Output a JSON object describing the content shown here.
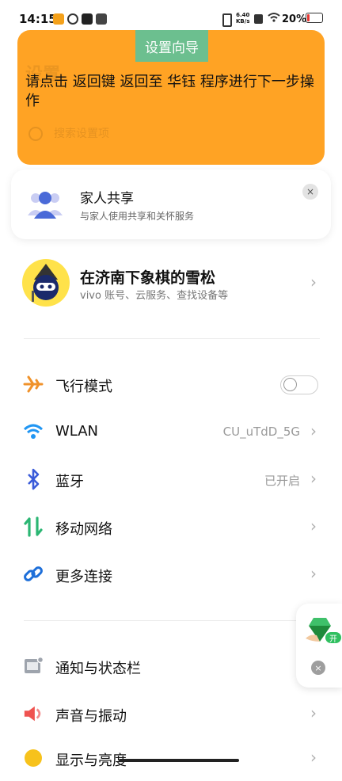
{
  "status_bar": {
    "time": "14:15",
    "net_speed_value": "6.40",
    "net_speed_unit": "KB/s",
    "battery": "20%",
    "battery_level": 0.2,
    "icons": [
      "weibo-icon",
      "link-app-icon",
      "tiktok-icon",
      "mail-icon",
      "vibrate-icon",
      "wifi-icon",
      "signal-off-icon",
      "battery-icon"
    ]
  },
  "overlay": {
    "ghost_title": "设置",
    "ghost_search": "搜索设置项",
    "wizard_tab": "设置向导",
    "instruction": "请点击 返回键 返回至 华钰 程序进行下一步操作",
    "color": "#ffa324",
    "tab_color": "#6cbf8f"
  },
  "family_card": {
    "title": "家人共享",
    "subtitle": "与家人使用共享和关怀服务",
    "close": "×"
  },
  "account": {
    "name": "在济南下象棋的雪松",
    "subtitle": "vivo 账号、云服务、查找设备等",
    "chevron": "›"
  },
  "connectivity": [
    {
      "label": "飞行模式",
      "value": "",
      "icon": "airplane-icon",
      "toggle": false
    },
    {
      "label": "WLAN",
      "value": "CU_uTdD_5G",
      "icon": "wifi-icon"
    },
    {
      "label": "蓝牙",
      "value": "已开启",
      "icon": "bluetooth-icon"
    },
    {
      "label": "移动网络",
      "value": "",
      "icon": "mobile-network-icon"
    },
    {
      "label": "更多连接",
      "value": "",
      "icon": "link-icon"
    }
  ],
  "general": [
    {
      "label": "通知与状态栏",
      "icon": "notification-icon"
    },
    {
      "label": "声音与振动",
      "icon": "sound-icon"
    },
    {
      "label": "显示与亮度",
      "icon": "brightness-icon"
    }
  ],
  "chevron": "›",
  "floating_widget": {
    "badge": "开",
    "close": "×"
  }
}
